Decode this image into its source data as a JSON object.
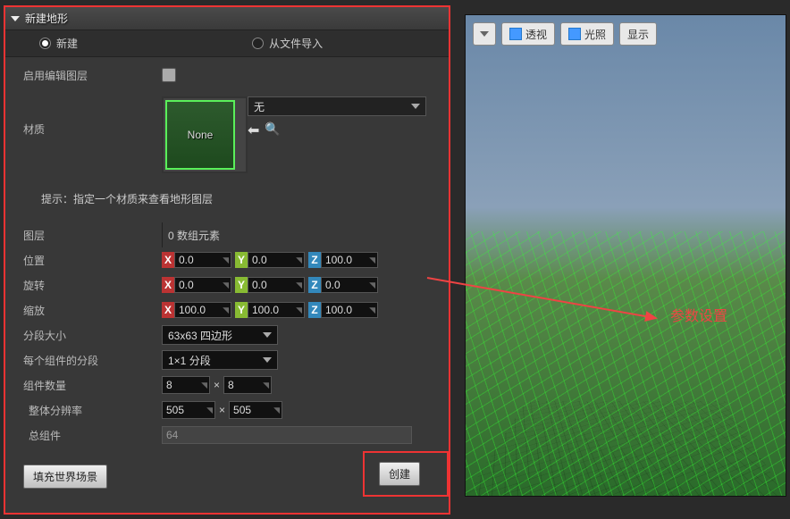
{
  "panel": {
    "title": "新建地形",
    "radio_new": "新建",
    "radio_import": "从文件导入",
    "radio_selected": "new"
  },
  "props": {
    "enable_edit_layers_label": "启用编辑图层",
    "material_label": "材质",
    "material_swatch_text": "None",
    "material_dropdown": "无",
    "hint": "提示：指定一个材质来查看地形图层",
    "layers_label": "图层",
    "layers_value": "0 数组元素",
    "position_label": "位置",
    "position": {
      "x": "0.0",
      "y": "0.0",
      "z": "100.0"
    },
    "rotation_label": "旋转",
    "rotation": {
      "x": "0.0",
      "y": "0.0",
      "z": "0.0"
    },
    "scale_label": "缩放",
    "scale": {
      "x": "100.0",
      "y": "100.0",
      "z": "100.0"
    },
    "section_size_label": "分段大小",
    "section_size_value": "63x63 四边形",
    "sections_per_label": "每个组件的分段",
    "sections_per_value": "1×1 分段",
    "components_label": "组件数量",
    "components": {
      "x": "8",
      "y": "8"
    },
    "resolution_label": "整体分辨率",
    "resolution": {
      "x": "505",
      "y": "505"
    },
    "total_label": "总组件",
    "total_value": "64"
  },
  "buttons": {
    "fill_world": "填充世界场景",
    "create": "创建"
  },
  "viewport": {
    "perspective": "透视",
    "lit": "光照",
    "show": "显示"
  },
  "annotation": "参数设置"
}
